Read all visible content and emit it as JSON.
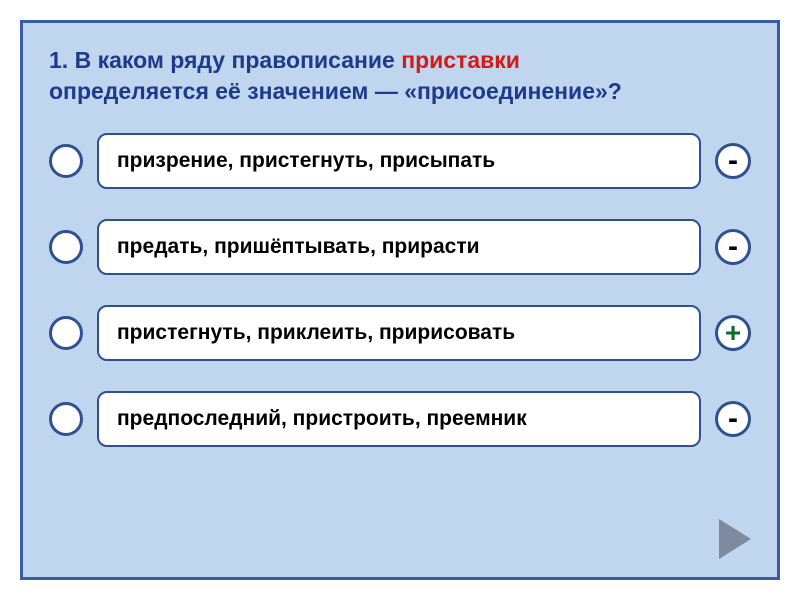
{
  "question": {
    "number": "1.",
    "part1": "В каком ряду правописание",
    "keyword": "приставки",
    "part2": "определяется её значением — «присоединение»?"
  },
  "options": [
    {
      "text": "призрение, пристегнуть, присыпать",
      "mark": "-"
    },
    {
      "text": "предать, пришёптывать, прирасти",
      "mark": "-"
    },
    {
      "text": "пристегнуть, приклеить, пририсовать",
      "mark": "+"
    },
    {
      "text": "предпоследний, пристроить, преемник",
      "mark": "-"
    }
  ]
}
